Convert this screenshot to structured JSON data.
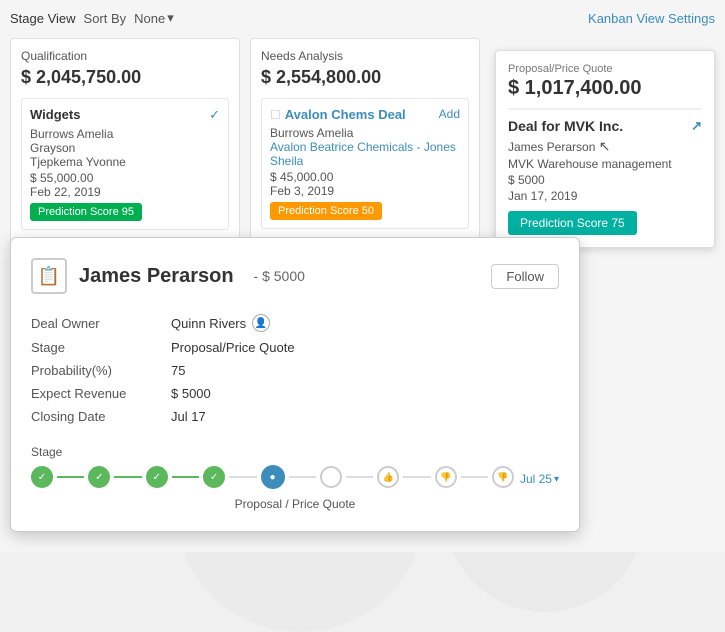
{
  "toolbar": {
    "stage_view": "Stage View",
    "sort_by": "Sort By",
    "sort_value": "None",
    "kanban_settings": "Kanban View Settings"
  },
  "columns": [
    {
      "id": "qualification",
      "title": "Qualification",
      "total": "$ 2,045,750.00",
      "cards": [
        {
          "title": "Widgets",
          "is_link": false,
          "persons": [
            "Burrows Amelia",
            "Grayson",
            "Tjepkema Yvonne"
          ],
          "amount": "$ 55,000.00",
          "date": "Feb 22, 2019",
          "prediction_label": "Prediction Score 95",
          "prediction_class": "green"
        }
      ]
    },
    {
      "id": "needs_analysis",
      "title": "Needs Analysis",
      "total": "$ 2,554,800.00",
      "cards": [
        {
          "title": "Avalon Chems Deal",
          "is_link": true,
          "persons": [
            "Burrows Amelia"
          ],
          "sub": "Avalon Beatrice Chemicals - Jones Sheila",
          "amount": "$ 45,000.00",
          "date": "Feb 3, 2019",
          "prediction_label": "Prediction Score 50",
          "prediction_class": "orange"
        }
      ]
    }
  ],
  "proposal_card": {
    "title": "Proposal/Price Quote",
    "total": "$ 1,017,400.00",
    "deal_name": "Deal for MVK Inc.",
    "person": "James Perarson",
    "description": "MVK Warehouse management",
    "amount": "$ 5000",
    "date": "Jan 17, 2019",
    "prediction_label": "Prediction Score 75",
    "prediction_class": "teal"
  },
  "detail_popup": {
    "icon": "📋",
    "title": "James Perarson",
    "subtitle": "- $ 5000",
    "follow_label": "Follow",
    "fields": [
      {
        "label": "Deal Owner",
        "value": "Quinn Rivers",
        "has_user_icon": true
      },
      {
        "label": "Stage",
        "value": "Proposal/Price Quote",
        "has_user_icon": false
      },
      {
        "label": "Probability(%)",
        "value": "75",
        "has_user_icon": false
      },
      {
        "label": "Expect Revenue",
        "value": "$ 5000",
        "has_user_icon": false
      },
      {
        "label": "Closing Date",
        "value": "Jul 17",
        "has_user_icon": false
      }
    ],
    "stage_section": {
      "label": "Stage",
      "dots": [
        {
          "state": "done",
          "icon": "✓"
        },
        {
          "state": "done",
          "icon": "✓"
        },
        {
          "state": "done",
          "icon": "✓"
        },
        {
          "state": "done",
          "icon": "✓"
        },
        {
          "state": "active",
          "icon": "●"
        },
        {
          "state": "neutral",
          "icon": ""
        },
        {
          "state": "neutral",
          "icon": "👍"
        },
        {
          "state": "neutral",
          "icon": "👎"
        },
        {
          "state": "neutral",
          "icon": "👎"
        }
      ],
      "date_label": "Jul 25",
      "stage_name": "Proposal / Price Quote"
    }
  }
}
